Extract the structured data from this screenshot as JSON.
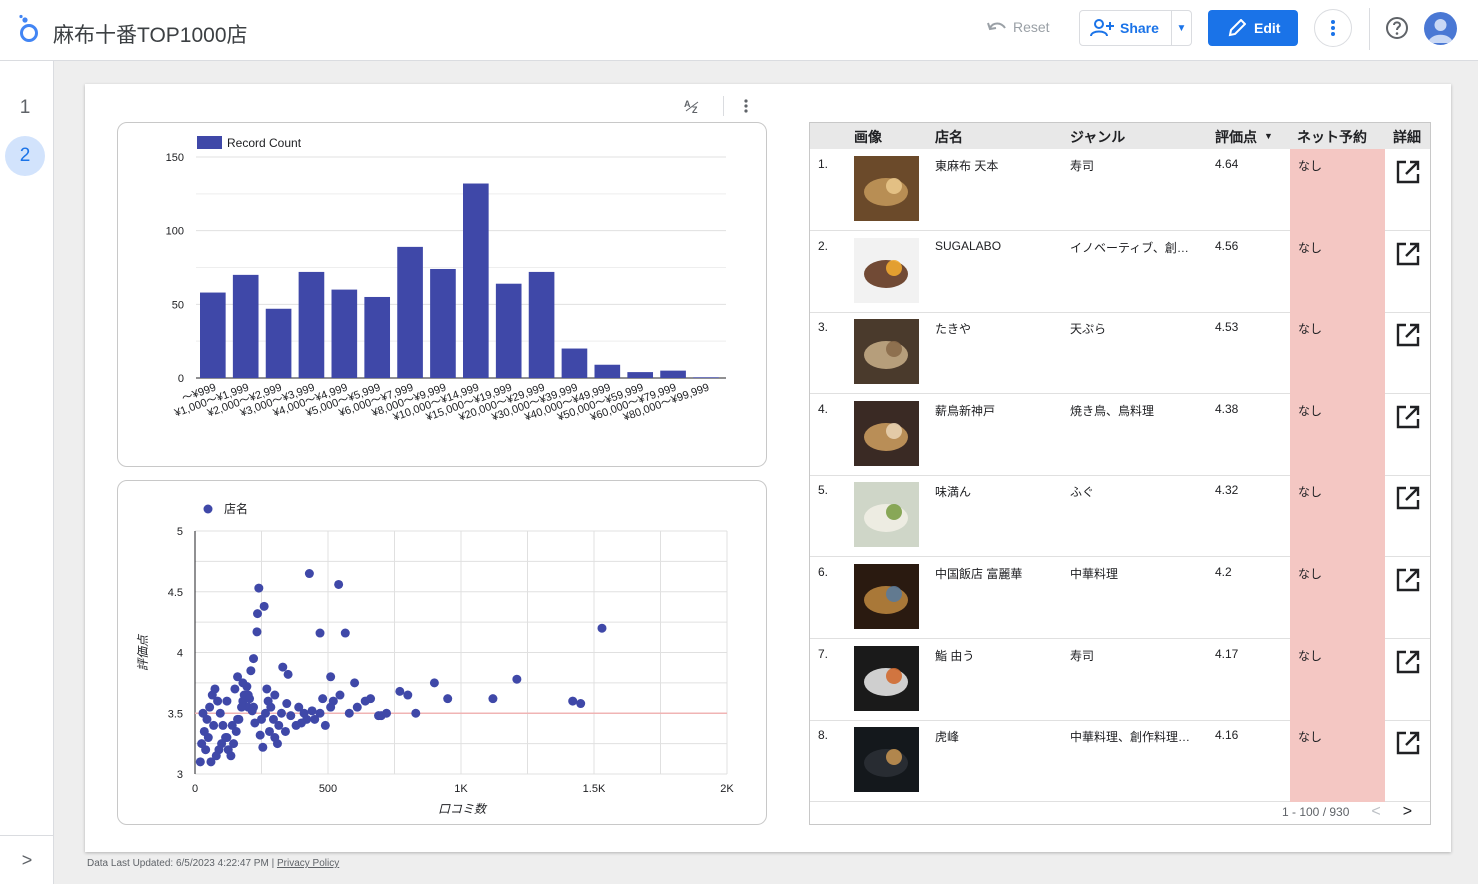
{
  "header": {
    "title": "麻布十番TOP1000店",
    "reset_label": "Reset",
    "share_label": "Share",
    "edit_label": "Edit"
  },
  "rail": {
    "pages": [
      "1",
      "2"
    ],
    "active_page": "2"
  },
  "colors": {
    "accent": "#1a73e8",
    "bar": "#3f48a8",
    "highlight": "#f4c7c3",
    "refline": "#f0b4b4"
  },
  "bar_chart": {
    "chart_data": {
      "type": "bar",
      "categories": [
        "～¥999",
        "¥1,000～¥1,999",
        "¥2,000～¥2,999",
        "¥3,000～¥3,999",
        "¥4,000～¥4,999",
        "¥5,000～¥5,999",
        "¥6,000～¥7,999",
        "¥8,000～¥9,999",
        "¥10,000～¥14,999",
        "¥15,000～¥19,999",
        "¥20,000～¥29,999",
        "¥30,000～¥39,999",
        "¥40,000～¥49,999",
        "¥50,000～¥59,999",
        "¥60,000～¥79,999",
        "¥80,000～¥99,999"
      ],
      "series": [
        {
          "name": "Record Count",
          "values": [
            58,
            70,
            47,
            72,
            60,
            55,
            89,
            74,
            132,
            64,
            72,
            20,
            9,
            4,
            5,
            0.5
          ]
        }
      ],
      "yticks": [
        "0",
        "50",
        "100",
        "150"
      ],
      "ylim": [
        0,
        150
      ],
      "legend": "top-left"
    }
  },
  "scatter_chart": {
    "chart_data": {
      "type": "scatter",
      "series": [
        {
          "name": "店名",
          "x": [
            430,
            540,
            240,
            260,
            235,
            233,
            1530,
            470,
            565,
            210,
            330,
            220,
            350,
            900,
            1210,
            950,
            510,
            600,
            770,
            800,
            1120,
            1420,
            1450,
            830,
            520,
            545,
            610,
            660,
            700,
            270,
            300,
            180,
            200,
            160,
            140,
            120,
            100,
            90,
            300,
            340,
            380,
            420,
            470,
            120,
            150,
            160,
            180,
            200,
            220,
            250,
            280,
            310,
            60,
            80,
            40,
            50,
            70,
            30,
            20,
            25,
            35,
            45,
            55,
            65,
            75,
            85,
            95,
            105,
            115,
            125,
            135,
            145,
            155,
            165,
            175,
            185,
            195,
            205,
            215,
            225,
            245,
            255,
            265,
            275,
            285,
            295,
            315,
            325,
            345,
            360,
            400,
            440,
            480,
            390,
            410,
            450,
            490,
            510,
            580,
            640,
            690,
            720
          ],
          "y": [
            4.65,
            4.56,
            4.53,
            4.38,
            4.32,
            4.17,
            4.2,
            4.16,
            4.16,
            3.85,
            3.88,
            3.95,
            3.82,
            3.75,
            3.78,
            3.62,
            3.8,
            3.75,
            3.68,
            3.65,
            3.62,
            3.6,
            3.58,
            3.5,
            3.6,
            3.65,
            3.55,
            3.62,
            3.48,
            3.7,
            3.65,
            3.6,
            3.55,
            3.45,
            3.4,
            3.3,
            3.25,
            3.2,
            3.3,
            3.35,
            3.4,
            3.45,
            3.5,
            3.6,
            3.7,
            3.8,
            3.75,
            3.65,
            3.55,
            3.45,
            3.35,
            3.25,
            3.1,
            3.15,
            3.2,
            3.3,
            3.4,
            3.5,
            3.1,
            3.25,
            3.35,
            3.45,
            3.55,
            3.65,
            3.7,
            3.6,
            3.5,
            3.4,
            3.3,
            3.2,
            3.15,
            3.25,
            3.35,
            3.45,
            3.55,
            3.65,
            3.72,
            3.62,
            3.52,
            3.42,
            3.32,
            3.22,
            3.5,
            3.6,
            3.55,
            3.45,
            3.4,
            3.5,
            3.58,
            3.48,
            3.42,
            3.52,
            3.62,
            3.55,
            3.5,
            3.45,
            3.4,
            3.55,
            3.5,
            3.6,
            3.48,
            3.5
          ]
        }
      ],
      "xlabel": "口コミ数",
      "ylabel": "評価点",
      "xticks": [
        "0",
        "500",
        "1K",
        "1.5K",
        "2K"
      ],
      "yticks": [
        "3",
        "3.5",
        "4",
        "4.5",
        "5"
      ],
      "xlim": [
        0,
        2000
      ],
      "ylim": [
        3,
        5
      ],
      "reference_line": 3.5,
      "legend": "top-left"
    }
  },
  "table": {
    "headers": {
      "image": "画像",
      "name": "店名",
      "genre": "ジャンル",
      "score": "評価点",
      "score_sort": "▼",
      "net": "ネット予約",
      "detail": "詳細"
    },
    "rows": [
      {
        "num": "1.",
        "name": "東麻布 天本",
        "genre": "寿司",
        "score": "4.64",
        "net": "なし",
        "img": "sushi-counter"
      },
      {
        "num": "2.",
        "name": "SUGALABO",
        "genre": "イノベーティブ、創作...",
        "score": "4.56",
        "net": "なし",
        "img": "plated-dish"
      },
      {
        "num": "3.",
        "name": "たきや",
        "genre": "天ぷら",
        "score": "4.53",
        "net": "なし",
        "img": "tempura-counter"
      },
      {
        "num": "4.",
        "name": "薪鳥新神戸",
        "genre": "焼き鳥、鳥料理",
        "score": "4.38",
        "net": "なし",
        "img": "grilled-chicken"
      },
      {
        "num": "5.",
        "name": "味満ん",
        "genre": "ふぐ",
        "score": "4.32",
        "net": "なし",
        "img": "fugu-dish"
      },
      {
        "num": "6.",
        "name": "中国飯店 富麗華",
        "genre": "中華料理",
        "score": "4.2",
        "net": "なし",
        "img": "chinese-interior"
      },
      {
        "num": "7.",
        "name": "鮨 由う",
        "genre": "寿司",
        "score": "4.17",
        "net": "なし",
        "img": "sushi-bowl"
      },
      {
        "num": "8.",
        "name": "虎峰",
        "genre": "中華料理、創作料理、...",
        "score": "4.16",
        "net": "なし",
        "img": "dark-interior"
      }
    ],
    "pagination": "1 - 100 / 930"
  },
  "footer": {
    "updated": "Data Last Updated: 6/5/2023 4:22:47 PM",
    "privacy": "Privacy Policy"
  }
}
